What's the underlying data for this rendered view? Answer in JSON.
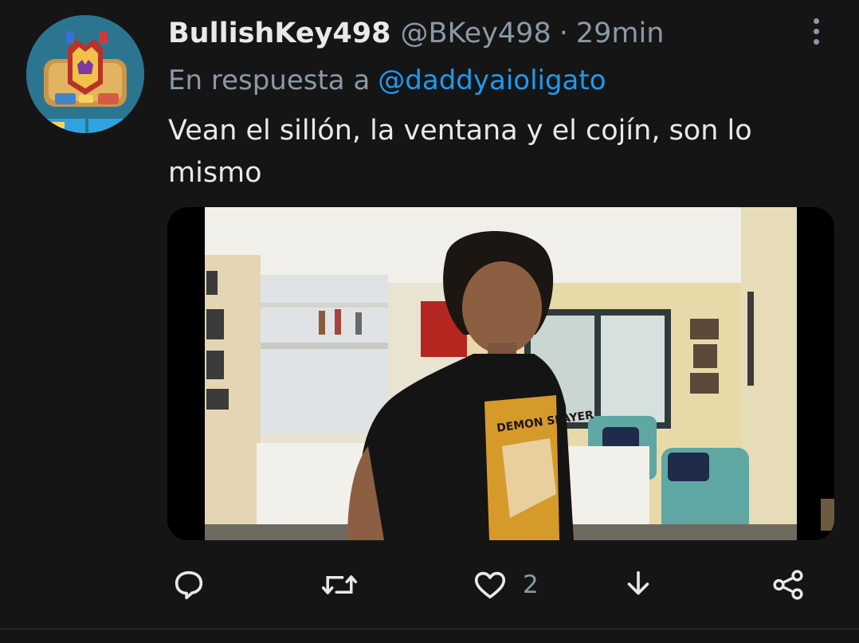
{
  "tweet": {
    "display_name": "BullishKey498",
    "handle": "@BKey498",
    "separator": "·",
    "time": "29min",
    "reply_prefix": "En respuesta a",
    "reply_mention": "@daddyaioligato",
    "text": "Vean el sillón, la ventana y el cojín, son lo mismo"
  },
  "media": {
    "shirt_print": "DEMON SLAYER"
  },
  "actions": {
    "reply_icon": "comment-bubble-icon",
    "retweet_icon": "retweet-icon",
    "like_icon": "heart-icon",
    "like_count": "2",
    "save_icon": "download-arrow-icon",
    "share_icon": "share-nodes-icon"
  },
  "colors": {
    "background": "#151515",
    "primary_text": "#e7e9ea",
    "secondary_text": "#8b98a5",
    "link": "#1d9bf0"
  }
}
